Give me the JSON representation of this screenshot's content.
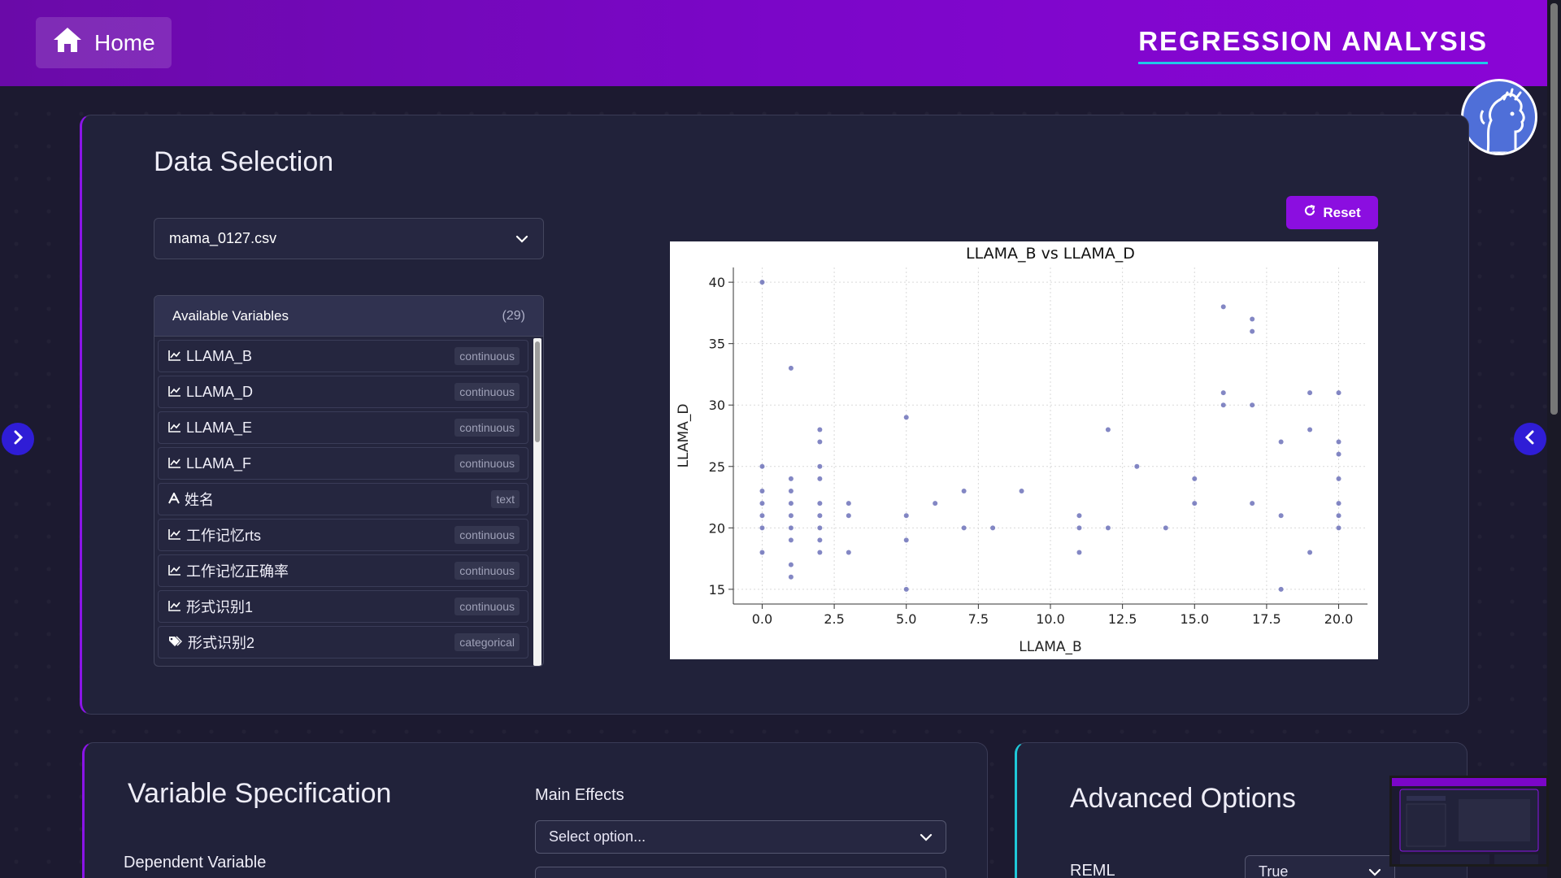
{
  "header": {
    "home_label": "Home",
    "app_title": "REGRESSION ANALYSIS"
  },
  "data_selection": {
    "title": "Data Selection",
    "file_value": "mama_0127.csv",
    "available_label": "Available Variables",
    "available_count": "(29)",
    "reset_label": "Reset",
    "variables": [
      {
        "name": "LLAMA_B",
        "type": "continuous",
        "icon": "chart-line-icon"
      },
      {
        "name": "LLAMA_D",
        "type": "continuous",
        "icon": "chart-line-icon"
      },
      {
        "name": "LLAMA_E",
        "type": "continuous",
        "icon": "chart-line-icon"
      },
      {
        "name": "LLAMA_F",
        "type": "continuous",
        "icon": "chart-line-icon"
      },
      {
        "name": "姓名",
        "type": "text",
        "icon": "text-font-icon"
      },
      {
        "name": "工作记忆rts",
        "type": "continuous",
        "icon": "chart-line-icon"
      },
      {
        "name": "工作记忆正确率",
        "type": "continuous",
        "icon": "chart-line-icon"
      },
      {
        "name": "形式识别1",
        "type": "continuous",
        "icon": "chart-line-icon"
      },
      {
        "name": "形式识别2",
        "type": "categorical",
        "icon": "tags-icon"
      }
    ]
  },
  "chart_data": {
    "type": "scatter",
    "title": "LLAMA_B vs LLAMA_D",
    "xlabel": "LLAMA_B",
    "ylabel": "LLAMA_D",
    "xlim": [
      -1,
      21
    ],
    "ylim": [
      13.8,
      41.2
    ],
    "xticks": [
      0.0,
      2.5,
      5.0,
      7.5,
      10.0,
      12.5,
      15.0,
      17.5,
      20.0
    ],
    "yticks": [
      15,
      20,
      25,
      30,
      35,
      40
    ],
    "grid": true,
    "color": "#5a5fb0",
    "points": [
      [
        0,
        40
      ],
      [
        0,
        25
      ],
      [
        0,
        23
      ],
      [
        0,
        22
      ],
      [
        0,
        21
      ],
      [
        0,
        20
      ],
      [
        0,
        18
      ],
      [
        1,
        33
      ],
      [
        1,
        24
      ],
      [
        1,
        23
      ],
      [
        1,
        22
      ],
      [
        1,
        21
      ],
      [
        1,
        20
      ],
      [
        1,
        19
      ],
      [
        1,
        17
      ],
      [
        1,
        16
      ],
      [
        2,
        28
      ],
      [
        2,
        27
      ],
      [
        2,
        25
      ],
      [
        2,
        24
      ],
      [
        2,
        22
      ],
      [
        2,
        21
      ],
      [
        2,
        20
      ],
      [
        2,
        19
      ],
      [
        2,
        18
      ],
      [
        3,
        22
      ],
      [
        3,
        21
      ],
      [
        3,
        18
      ],
      [
        5,
        29
      ],
      [
        5,
        21
      ],
      [
        5,
        19
      ],
      [
        5,
        15
      ],
      [
        6,
        22
      ],
      [
        7,
        23
      ],
      [
        7,
        20
      ],
      [
        8,
        20
      ],
      [
        9,
        23
      ],
      [
        11,
        21
      ],
      [
        11,
        20
      ],
      [
        11,
        18
      ],
      [
        12,
        28
      ],
      [
        12,
        20
      ],
      [
        13,
        25
      ],
      [
        14,
        20
      ],
      [
        15,
        24
      ],
      [
        15,
        22
      ],
      [
        16,
        38
      ],
      [
        16,
        31
      ],
      [
        16,
        30
      ],
      [
        17,
        37
      ],
      [
        17,
        36
      ],
      [
        17,
        30
      ],
      [
        17,
        22
      ],
      [
        18,
        27
      ],
      [
        18,
        21
      ],
      [
        18,
        15
      ],
      [
        19,
        31
      ],
      [
        19,
        28
      ],
      [
        19,
        18
      ],
      [
        20,
        31
      ],
      [
        20,
        27
      ],
      [
        20,
        26
      ],
      [
        20,
        24
      ],
      [
        20,
        22
      ],
      [
        20,
        21
      ],
      [
        20,
        20
      ]
    ]
  },
  "variable_spec": {
    "title": "Variable Specification",
    "dependent_label": "Dependent Variable",
    "main_effects_label": "Main Effects",
    "main_effects_placeholder": "Select option..."
  },
  "advanced": {
    "title": "Advanced Options",
    "reml_label": "REML",
    "reml_value": "True"
  }
}
